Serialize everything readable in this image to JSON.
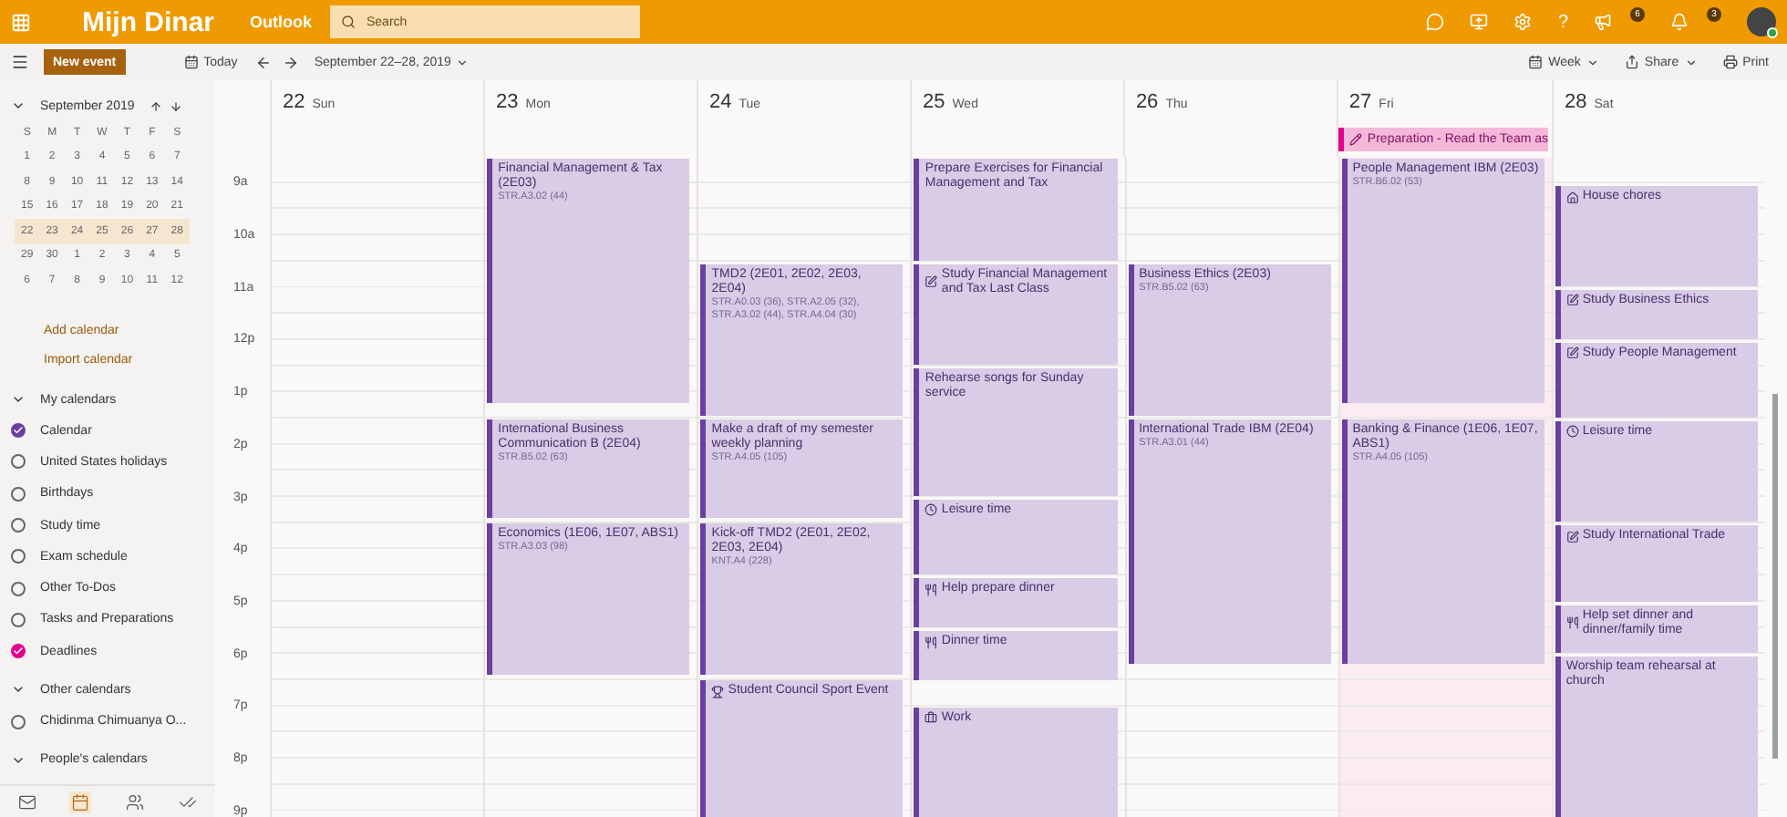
{
  "topbar": {
    "app_title": "Mijn Dinar",
    "brand": "Outlook",
    "search": {
      "placeholder": "Search"
    },
    "help_label": "?",
    "badges": [
      {
        "kind": "megaphone",
        "count": "6"
      },
      {
        "kind": "bell",
        "count": "3"
      }
    ]
  },
  "toolbar": {
    "new_event": "New event",
    "today": "Today",
    "range": "September 22–28, 2019",
    "view": "Week",
    "share": "Share",
    "print": "Print"
  },
  "sidebar": {
    "mini_calendar": {
      "month": "September 2019",
      "weekdays": [
        "S",
        "M",
        "T",
        "W",
        "T",
        "F",
        "S"
      ],
      "weeks": [
        {
          "selected": false,
          "days": [
            "1",
            "2",
            "3",
            "4",
            "5",
            "6",
            "7"
          ]
        },
        {
          "selected": false,
          "days": [
            "8",
            "9",
            "10",
            "11",
            "12",
            "13",
            "14"
          ]
        },
        {
          "selected": false,
          "days": [
            "15",
            "16",
            "17",
            "18",
            "19",
            "20",
            "21"
          ]
        },
        {
          "selected": true,
          "days": [
            "22",
            "23",
            "24",
            "25",
            "26",
            "27",
            "28"
          ]
        },
        {
          "selected": false,
          "days": [
            "29",
            "30",
            "1",
            "2",
            "3",
            "4",
            "5"
          ]
        },
        {
          "selected": false,
          "days": [
            "6",
            "7",
            "8",
            "9",
            "10",
            "11",
            "12"
          ]
        }
      ]
    },
    "links": [
      "Add calendar",
      "Import calendar"
    ],
    "groups": [
      {
        "title": "My calendars",
        "expanded": true,
        "items": [
          {
            "label": "Calendar",
            "checked": true,
            "color": "#6b3fa0"
          },
          {
            "label": "United States holidays",
            "checked": false
          },
          {
            "label": "Birthdays",
            "checked": false
          },
          {
            "label": "Study time",
            "checked": false
          },
          {
            "label": "Exam schedule",
            "checked": false
          },
          {
            "label": "Other To-Dos",
            "checked": false
          },
          {
            "label": "Tasks and Preparations",
            "checked": false
          },
          {
            "label": "Deadlines",
            "checked": true,
            "color": "#e3008c"
          }
        ]
      },
      {
        "title": "Other calendars",
        "expanded": true,
        "items": [
          {
            "label": "Chidinma Chimuanya O...",
            "checked": false
          }
        ]
      },
      {
        "title": "People's calendars",
        "expanded": true
      }
    ],
    "nav": [
      {
        "kind": "mail",
        "selected": false
      },
      {
        "kind": "calendar",
        "selected": true
      },
      {
        "kind": "people",
        "selected": false
      },
      {
        "kind": "todo",
        "selected": false
      }
    ]
  },
  "hours": [
    "9a",
    "10a",
    "11a",
    "12p",
    "1p",
    "2p",
    "3p",
    "4p",
    "5p",
    "6p",
    "7p",
    "8p",
    "9p"
  ],
  "days": [
    {
      "number": "22",
      "name": "Sun",
      "today": false
    },
    {
      "number": "23",
      "name": "Mon",
      "today": false,
      "events": [
        {
          "title": "Financial Management & Tax (2E03)",
          "location": "STR.A3.02 (44)"
        },
        {
          "title": "International Business Communication B (2E04)",
          "location": "STR.B5.02 (63)"
        },
        {
          "title": "Economics (1E06, 1E07, ABS1)",
          "location": "STR.A3.03 (98)"
        }
      ]
    },
    {
      "number": "24",
      "name": "Tue",
      "today": false,
      "events": [
        {
          "title": "TMD2 (2E01, 2E02, 2E03, 2E04)",
          "location": "STR.A0.03 (36), STR.A2.05 (32), STR.A3.02 (44), STR.A4.04 (30)"
        },
        {
          "title": "Make a draft of my semester weekly planning",
          "location": "STR.A4.05 (105)"
        },
        {
          "title": "Kick-off TMD2 (2E01, 2E02, 2E03, 2E04)",
          "location": "KNT.A4 (228)"
        },
        {
          "title": "Student Council Sport Event",
          "kind": "trophy"
        }
      ]
    },
    {
      "number": "25",
      "name": "Wed",
      "today": false,
      "events": [
        {
          "title": "Prepare Exercises for Financial Management and Tax"
        },
        {
          "title": "Study Financial Management and Tax Last Class",
          "kind": "study"
        },
        {
          "title": "Rehearse songs for Sunday service"
        },
        {
          "title": "Leisure time",
          "kind": "clock"
        },
        {
          "title": "Help prepare dinner",
          "kind": "dinner"
        },
        {
          "title": "Dinner time",
          "kind": "dinner"
        },
        {
          "title": "Work",
          "kind": "work"
        }
      ]
    },
    {
      "number": "26",
      "name": "Thu",
      "today": false,
      "events": [
        {
          "title": "Business Ethics (2E03)",
          "location": "STR.B5.02 (63)"
        },
        {
          "title": "International Trade IBM (2E04)",
          "location": "STR.A3.01 (44)"
        }
      ]
    },
    {
      "number": "27",
      "name": "Fri",
      "today": true,
      "all_day": [
        {
          "title": "Preparation - Read the Team as"
        }
      ],
      "events": [
        {
          "title": "People Management IBM (2E03)",
          "location": "STR.B6.02 (53)"
        },
        {
          "title": "Banking & Finance (1E06, 1E07, ABS1)",
          "location": "STR.A4.05 (105)"
        }
      ]
    },
    {
      "number": "28",
      "name": "Sat",
      "today": false,
      "events": [
        {
          "title": "House chores",
          "kind": "home"
        },
        {
          "title": "Study Business Ethics",
          "kind": "study"
        },
        {
          "title": "Study People Management",
          "kind": "study"
        },
        {
          "title": "Leisure time",
          "kind": "clock"
        },
        {
          "title": "Study International Trade",
          "kind": "study"
        },
        {
          "title": "Help set dinner and dinner/family time",
          "kind": "dinner"
        },
        {
          "title": "Worship team rehearsal at church"
        }
      ]
    }
  ]
}
